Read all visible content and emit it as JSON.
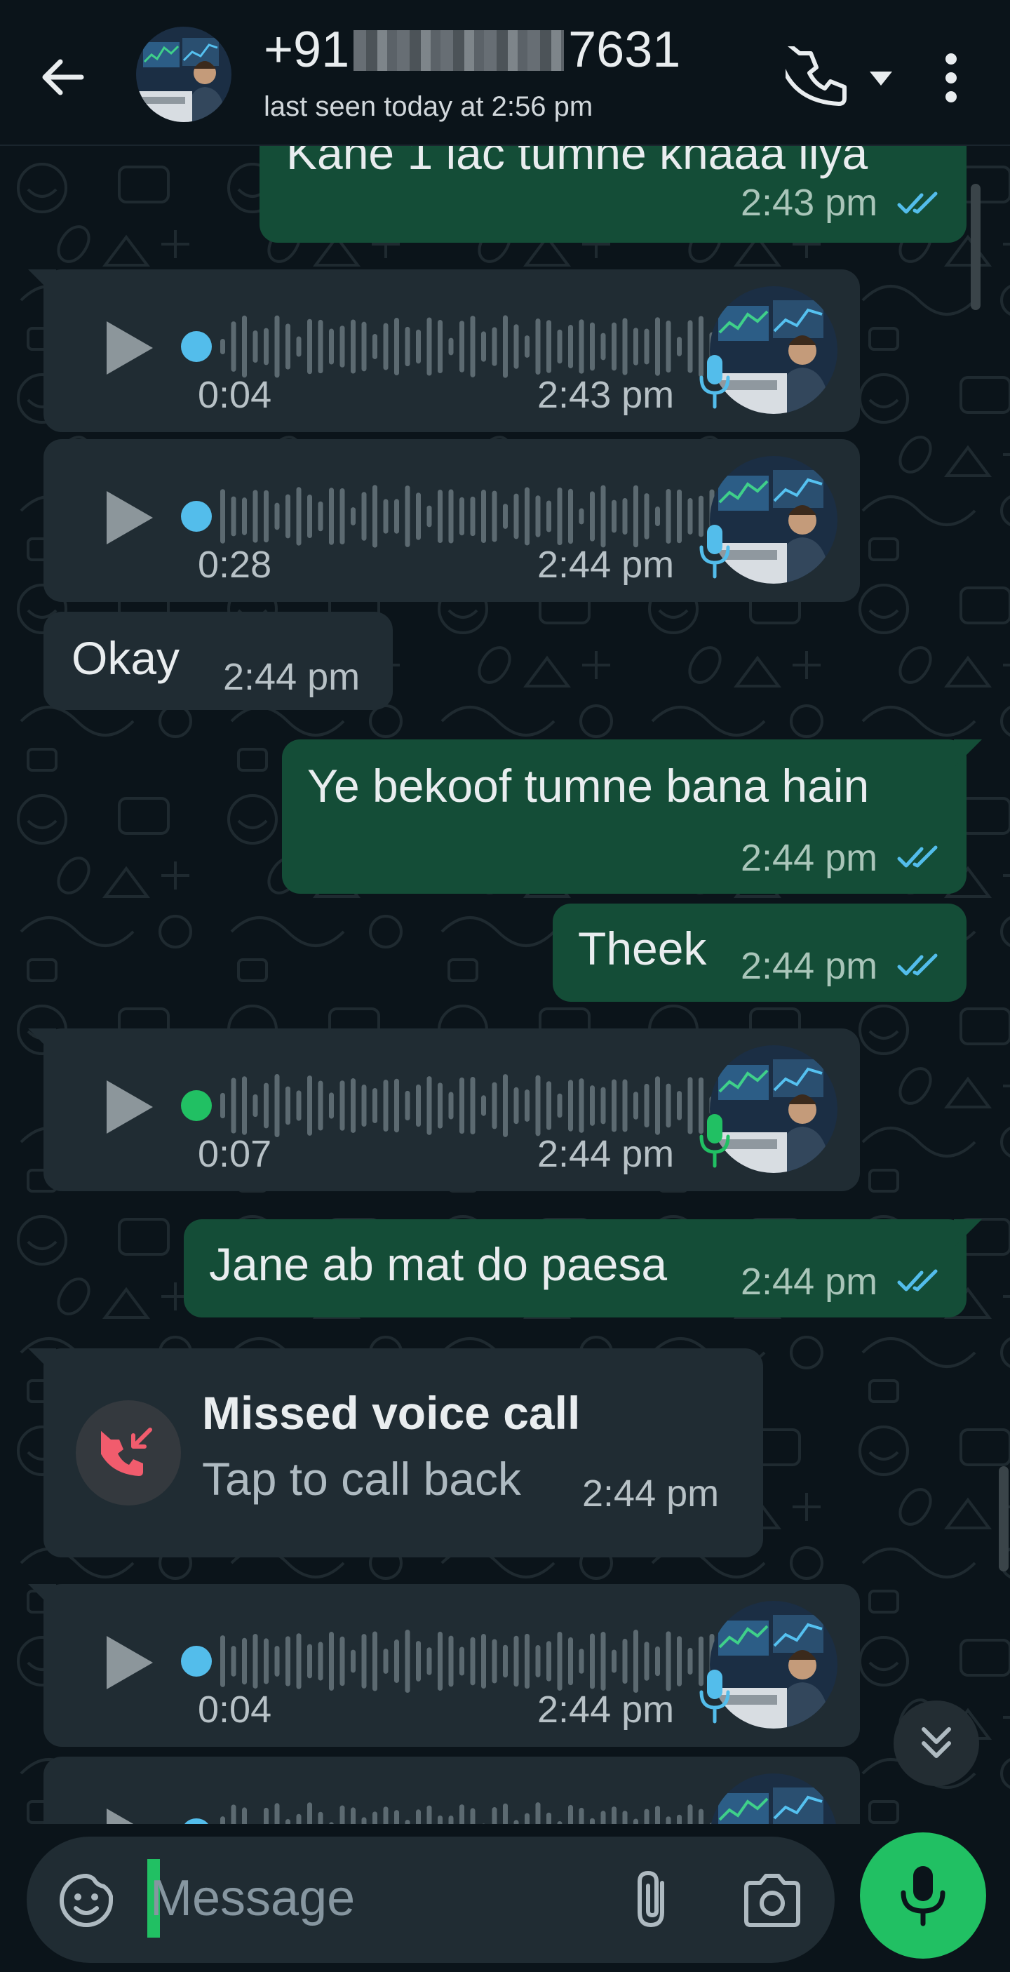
{
  "header": {
    "contact_prefix": "+91",
    "contact_suffix": "7631",
    "last_seen": "last seen today at 2:56 pm"
  },
  "messages": [
    {
      "type": "outgoing",
      "text": "Kahe 1 lac tumne khaaa liya",
      "time": "2:43 pm",
      "status": "read"
    },
    {
      "type": "voice",
      "duration": "0:04",
      "time": "2:43 pm",
      "played": true
    },
    {
      "type": "voice",
      "duration": "0:28",
      "time": "2:44 pm",
      "played": true
    },
    {
      "type": "incoming",
      "text": "Okay",
      "time": "2:44 pm"
    },
    {
      "type": "outgoing",
      "text": "Ye bekoof tumne bana hain",
      "time": "2:44 pm",
      "status": "read"
    },
    {
      "type": "outgoing",
      "text": "Theek",
      "time": "2:44 pm",
      "status": "read"
    },
    {
      "type": "voice",
      "duration": "0:07",
      "time": "2:44 pm",
      "played": false
    },
    {
      "type": "outgoing",
      "text": "Jane ab mat do paesa",
      "time": "2:44 pm",
      "status": "read"
    },
    {
      "type": "missed_call",
      "title": "Missed voice call",
      "subtitle": "Tap to call back",
      "time": "2:44 pm"
    },
    {
      "type": "voice",
      "duration": "0:04",
      "time": "2:44 pm",
      "played": true
    },
    {
      "type": "voice",
      "duration": "",
      "time": "",
      "played": true
    }
  ],
  "composer": {
    "placeholder": "Message"
  },
  "icons": {
    "back": "arrow-left-icon",
    "call": "phone-icon",
    "call_menu": "caret-down-icon",
    "menu": "more-vert-icon",
    "emoji": "sticker-emoji-icon",
    "attach": "paperclip-icon",
    "camera": "camera-icon",
    "mic": "microphone-icon",
    "scroll_down": "double-chevron-down-icon"
  },
  "colors": {
    "background": "#0b141a",
    "outgoing_bubble": "#144d37",
    "incoming_bubble": "#202c33",
    "read_ticks": "#53bdeb",
    "accent_green": "#21c063",
    "missed_call_red": "#f15c6d",
    "played_dot": "#53bdeb",
    "unplayed_dot": "#21c063"
  }
}
